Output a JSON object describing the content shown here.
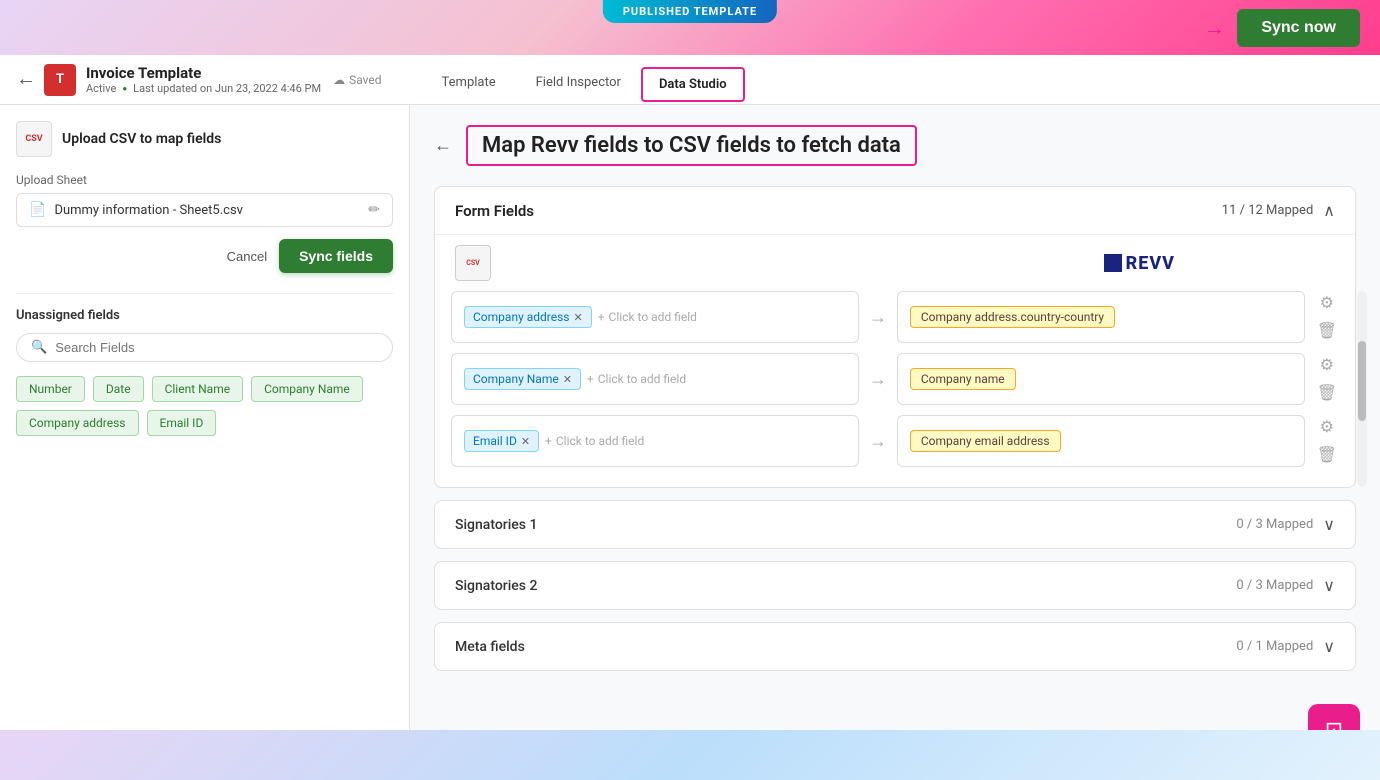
{
  "header": {
    "published_label": "PUBLISHED TEMPLATE",
    "sync_now_label": "Sync now",
    "arrow": "→"
  },
  "nav": {
    "back_icon": "←",
    "template_icon": "T",
    "template_name": "Invoice Template",
    "status": "Active",
    "last_updated": "Last updated on Jun 23, 2022 4:46 PM",
    "saved_label": "Saved",
    "tabs": [
      {
        "id": "template",
        "label": "Template"
      },
      {
        "id": "field-inspector",
        "label": "Field Inspector"
      },
      {
        "id": "data-studio",
        "label": "Data Studio",
        "active": true
      }
    ]
  },
  "sidebar": {
    "upload_section_title": "Upload CSV to map fields",
    "upload_sheet_label": "Upload Sheet",
    "file_name": "Dummy information - Sheet5.csv",
    "cancel_label": "Cancel",
    "sync_fields_label": "Sync fields",
    "unassigned_label": "Unassigned fields",
    "search_placeholder": "Search Fields",
    "tags": [
      {
        "id": "number",
        "label": "Number"
      },
      {
        "id": "date",
        "label": "Date"
      },
      {
        "id": "client-name",
        "label": "Client Name"
      },
      {
        "id": "company-name",
        "label": "Company Name"
      },
      {
        "id": "company-address",
        "label": "Company address"
      },
      {
        "id": "email-id",
        "label": "Email ID"
      }
    ]
  },
  "main": {
    "back_arrow": "←",
    "page_title": "Map Revv fields to CSV fields to fetch data",
    "form_fields": {
      "title": "Form Fields",
      "mapped": "11 / 12 Mapped",
      "revv_logo_text": "REVV",
      "rows": [
        {
          "id": "row-address",
          "left_chips": [
            "Company address"
          ],
          "add_hint": "Click to add field",
          "right_value": "Company address.country-country"
        },
        {
          "id": "row-company-name",
          "left_chips": [
            "Company Name"
          ],
          "add_hint": "Click to add field",
          "right_value": "Company name"
        },
        {
          "id": "row-email",
          "left_chips": [
            "Email ID"
          ],
          "add_hint": "Click to add field",
          "right_value": "Company email address"
        }
      ]
    },
    "signatories": [
      {
        "id": "sig1",
        "title": "Signatories 1",
        "mapped": "0 / 3 Mapped"
      },
      {
        "id": "sig2",
        "title": "Signatories 2",
        "mapped": "0 / 3 Mapped"
      },
      {
        "id": "meta",
        "title": "Meta fields",
        "mapped": "0 / 1 Mapped"
      }
    ]
  },
  "chat_icon": "⊡"
}
